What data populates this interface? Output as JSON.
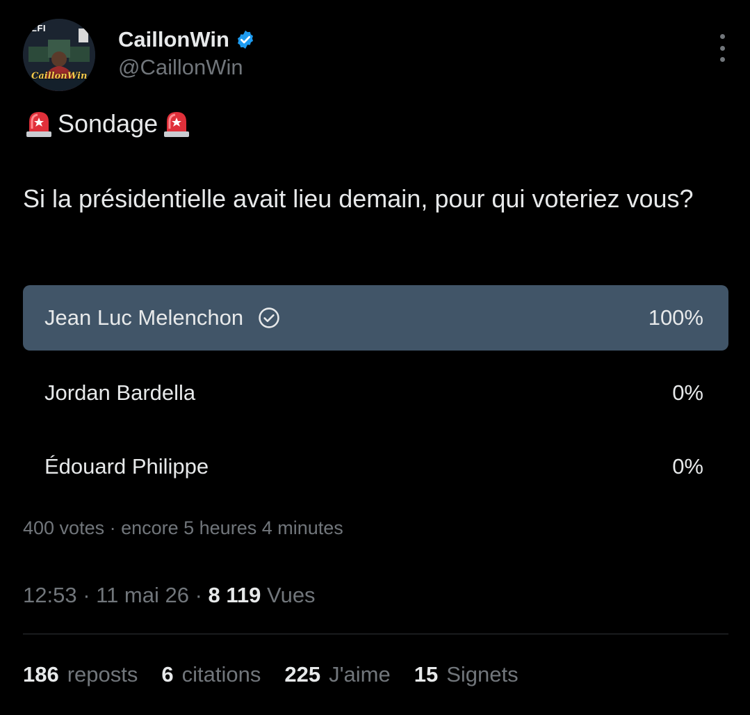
{
  "author": {
    "display_name": "CaillonWin",
    "handle": "@CaillonWin",
    "avatar_tag": "LFI",
    "avatar_name": "CaillonWin",
    "verified_color": "#1d9bf0"
  },
  "tweet": {
    "title": "Sondage",
    "title_icon": "siren-emoji",
    "body": "Si la présidentielle avait lieu demain, pour qui voteriez vous?"
  },
  "poll": {
    "options": [
      {
        "label": "Jean Luc Melenchon",
        "percent": "100%",
        "value": 100,
        "selected": true
      },
      {
        "label": "Jordan Bardella",
        "percent": "0%",
        "value": 0,
        "selected": false
      },
      {
        "label": "Édouard Philippe",
        "percent": "0%",
        "value": 0,
        "selected": false
      }
    ],
    "meta": "400 votes · encore 5 heures 4 minutes",
    "winner_color": "#415568"
  },
  "timestamp": {
    "time": "12:53",
    "date": "11 mai 26",
    "views_count": "8 119",
    "views_label": "Vues"
  },
  "stats": [
    {
      "count": "186",
      "label": "reposts"
    },
    {
      "count": "6",
      "label": "citations"
    },
    {
      "count": "225",
      "label": "J'aime"
    },
    {
      "count": "15",
      "label": "Signets"
    }
  ]
}
